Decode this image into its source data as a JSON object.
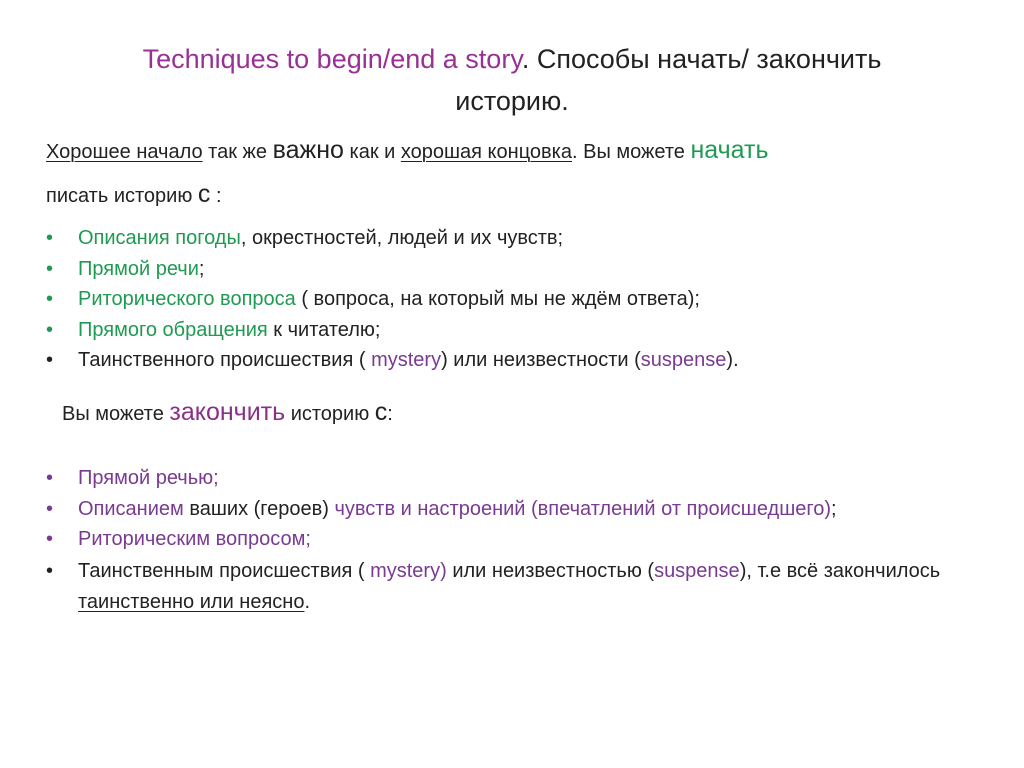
{
  "title": {
    "english": "Techniques to begin/end a story",
    "rest_line1": ".  Способы начать/ закончить",
    "line2": "историю."
  },
  "intro": {
    "p1": "Хорошее начало",
    "p2": " так же ",
    "p3": "важно",
    "p4": " как и ",
    "p5": "хорошая концовка",
    "p6": ". Вы можете ",
    "p7": "начать",
    "line2_a": "писать историю ",
    "line2_b": "с",
    "line2_c": " :"
  },
  "begin_list": [
    {
      "a": "Описания погоды",
      "b": ", окрестностей, людей и их чувств;"
    },
    {
      "a": "Прямой речи",
      "b": ";"
    },
    {
      "a": "Риторического вопроса",
      "b": " ( вопроса, на который мы не ждём ответа);"
    },
    {
      "a": "Прямого обращения",
      "b": " к читателю;"
    },
    {
      "a": "Таинственного происшествия ( ",
      "b": "mystery",
      "c": ") или неизвестности (",
      "d": "suspense",
      "e": ")."
    }
  ],
  "end_heading": {
    "a": "Вы можете ",
    "b": "закончить",
    "c": " историю ",
    "d": "с",
    "e": ":"
  },
  "end_list": [
    {
      "a": "Прямой речью;"
    },
    {
      "a": "Описанием",
      "b": " ваших (героев) ",
      "c": "чувств и настроений (впечатлений от происшедшего)",
      "d": ";"
    },
    {
      "a": "Риторическим вопросом;"
    },
    {
      "a": "Таинственным происшествия ( ",
      "b": "mystery)",
      "c": " или неизвестностью (",
      "d": "suspense",
      "e": "), т.е всё закончилось ",
      "f": "таинственно или неясно",
      "g": "."
    }
  ],
  "bullet_glyph": "•",
  "colors": {
    "green": "#1f9a52",
    "purple": "#7a3a92",
    "title_purple": "#9a2f95"
  }
}
